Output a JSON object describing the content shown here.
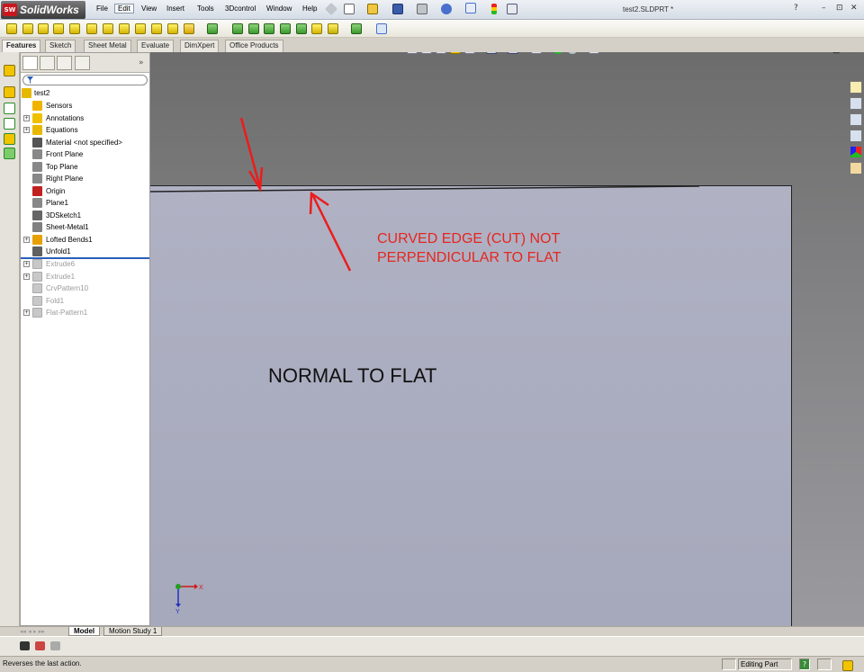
{
  "app": {
    "name": "SolidWorks",
    "logo_mark": "SW",
    "doc_title": "test2.SLDPRT *"
  },
  "menu": [
    "File",
    "Edit",
    "View",
    "Insert",
    "Tools",
    "3Dcontrol",
    "Window",
    "Help"
  ],
  "title_controls": {
    "help": "?",
    "minimize": "–",
    "restore": "⊡",
    "close": "✕"
  },
  "command_tabs": [
    "Features",
    "Sketch",
    "Sheet Metal",
    "Evaluate",
    "DimXpert",
    "Office Products"
  ],
  "feature_manager": {
    "expand_glyph": "»",
    "root": "test2",
    "nodes": [
      {
        "label": "Sensors",
        "icon": "sensors-icon",
        "color": "#f0b400",
        "expand": false
      },
      {
        "label": "Annotations",
        "icon": "annotations-icon",
        "color": "#f0c000",
        "expand": true
      },
      {
        "label": "Equations",
        "icon": "equations-icon",
        "color": "#e8b800",
        "expand": true
      },
      {
        "label": "Material <not specified>",
        "icon": "material-icon",
        "color": "#555555",
        "expand": false
      },
      {
        "label": "Front Plane",
        "icon": "plane-icon",
        "color": "#888888",
        "expand": false
      },
      {
        "label": "Top Plane",
        "icon": "plane-icon",
        "color": "#888888",
        "expand": false
      },
      {
        "label": "Right Plane",
        "icon": "plane-icon",
        "color": "#888888",
        "expand": false
      },
      {
        "label": "Origin",
        "icon": "origin-icon",
        "color": "#c02020",
        "expand": false
      },
      {
        "label": "Plane1",
        "icon": "plane-icon",
        "color": "#888888",
        "expand": false
      },
      {
        "label": "3DSketch1",
        "icon": "sketch3d-icon",
        "color": "#666666",
        "expand": false
      },
      {
        "label": "Sheet-Metal1",
        "icon": "sheet-metal-icon",
        "color": "#808080",
        "expand": false
      },
      {
        "label": "Lofted Bends1",
        "icon": "lofted-bends-icon",
        "color": "#e8a000",
        "expand": true
      },
      {
        "label": "Unfold1",
        "icon": "unfold-icon",
        "color": "#606060",
        "expand": false
      }
    ],
    "suppressed_nodes": [
      {
        "label": "Extrude6",
        "icon": "extrude-icon",
        "expand": true
      },
      {
        "label": "Extrude1",
        "icon": "extrude-icon",
        "expand": true
      },
      {
        "label": "CrvPattern10",
        "icon": "curve-pattern-icon",
        "expand": false
      },
      {
        "label": "Fold1",
        "icon": "fold-icon",
        "expand": false
      },
      {
        "label": "Flat-Pattern1",
        "icon": "flat-pattern-icon",
        "expand": true
      }
    ]
  },
  "bottom_tabs": [
    "Model",
    "Motion Study 1"
  ],
  "status": {
    "message": "Reverses the last action.",
    "mode": "Editing Part",
    "help_glyph": "?"
  },
  "graphics": {
    "annotation_red_line1": "CURVED EDGE (CUT) NOT",
    "annotation_red_line2": "PERPENDICULAR TO FLAT",
    "annotation_black": "NORMAL TO FLAT",
    "triad_x_label": "X",
    "triad_y_label": "Y",
    "annotation_color": "#e5261e",
    "face_color": "#aaacbf"
  }
}
